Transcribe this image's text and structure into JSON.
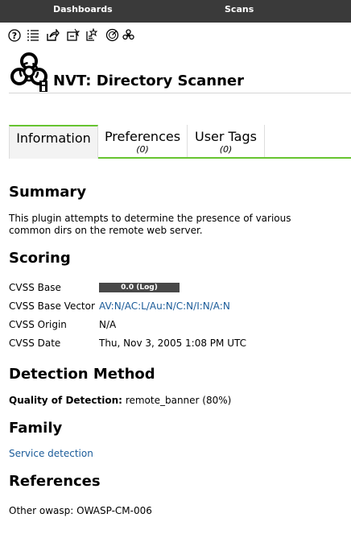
{
  "topbar": {
    "nav_dashboards": "Dashboards",
    "nav_scans": "Scans",
    "background": "#3a3a3a"
  },
  "toolbar": {
    "icons": [
      "help-icon",
      "list-icon",
      "export-icon",
      "new-override-icon",
      "new-note-icon",
      "results-icon",
      "vulnerabilities-icon"
    ]
  },
  "header": {
    "title": "NVT: Directory Scanner",
    "icon": "biohazard-icon"
  },
  "tabs": {
    "information": "Information",
    "preferences": "Preferences",
    "preferences_count": "(0)",
    "user_tags": "User Tags",
    "user_tags_count": "(0)",
    "accent": "#66c430"
  },
  "summary": {
    "heading": "Summary",
    "text_line1": "This plugin attempts to determine the presence of various",
    "text_line2": "common dirs on the remote web server."
  },
  "scoring": {
    "heading": "Scoring",
    "base_label": "CVSS Base",
    "base_value": "0.0 (Log)",
    "vector_label": "CVSS Base Vector",
    "vector_value": "AV:N/AC:L/Au:N/C:N/I:N/A:N",
    "origin_label": "CVSS Origin",
    "origin_value": "N/A",
    "date_label": "CVSS Date",
    "date_value": "Thu, Nov 3, 2005 1:08 PM UTC"
  },
  "detection": {
    "heading": "Detection Method",
    "qod_label": "Quality of Detection:",
    "qod_value": "remote_banner (80%)"
  },
  "family": {
    "heading": "Family",
    "value": "Service detection"
  },
  "references": {
    "heading": "References",
    "line": "Other owasp: OWASP-CM-006"
  }
}
